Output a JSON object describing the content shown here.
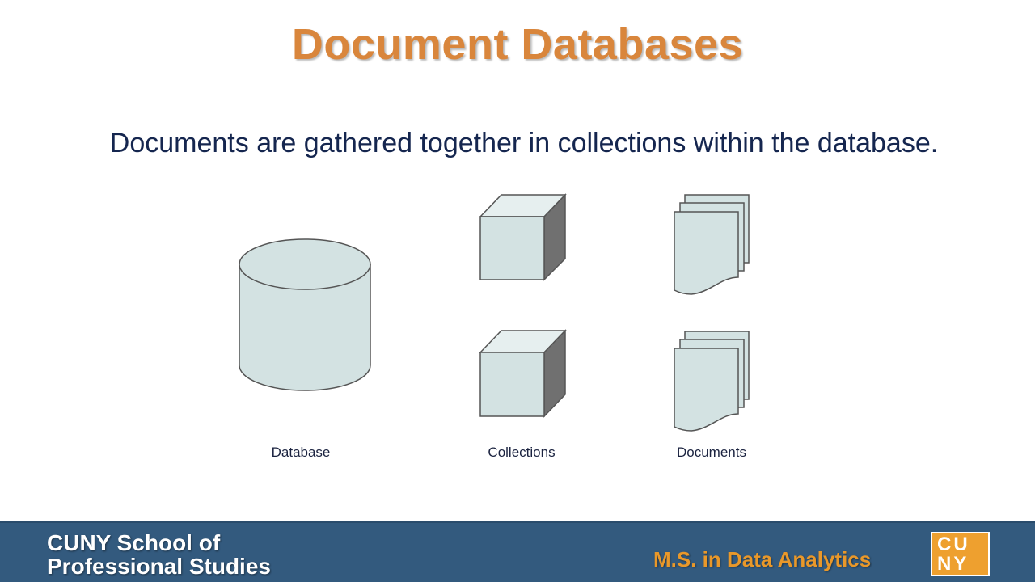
{
  "slide": {
    "title": "Document Databases",
    "subtitle": "Documents are gathered together in collections within the database."
  },
  "diagram": {
    "labels": {
      "database": "Database",
      "collections": "Collections",
      "documents": "Documents"
    }
  },
  "footer": {
    "school_line1": "CUNY School of",
    "school_line2": "Professional Studies",
    "program": "M.S. in Data Analytics",
    "logo_line1": "CU",
    "logo_line2": "NY"
  },
  "colors": {
    "title": "#d9863c",
    "subtitle": "#15264f",
    "shape_fill": "#d3e2e2",
    "shape_stroke": "#555555",
    "cube_side": "#707070",
    "footer_bg": "#335a7e",
    "program_text": "#e9982a",
    "logo_bg": "#eea02f"
  }
}
